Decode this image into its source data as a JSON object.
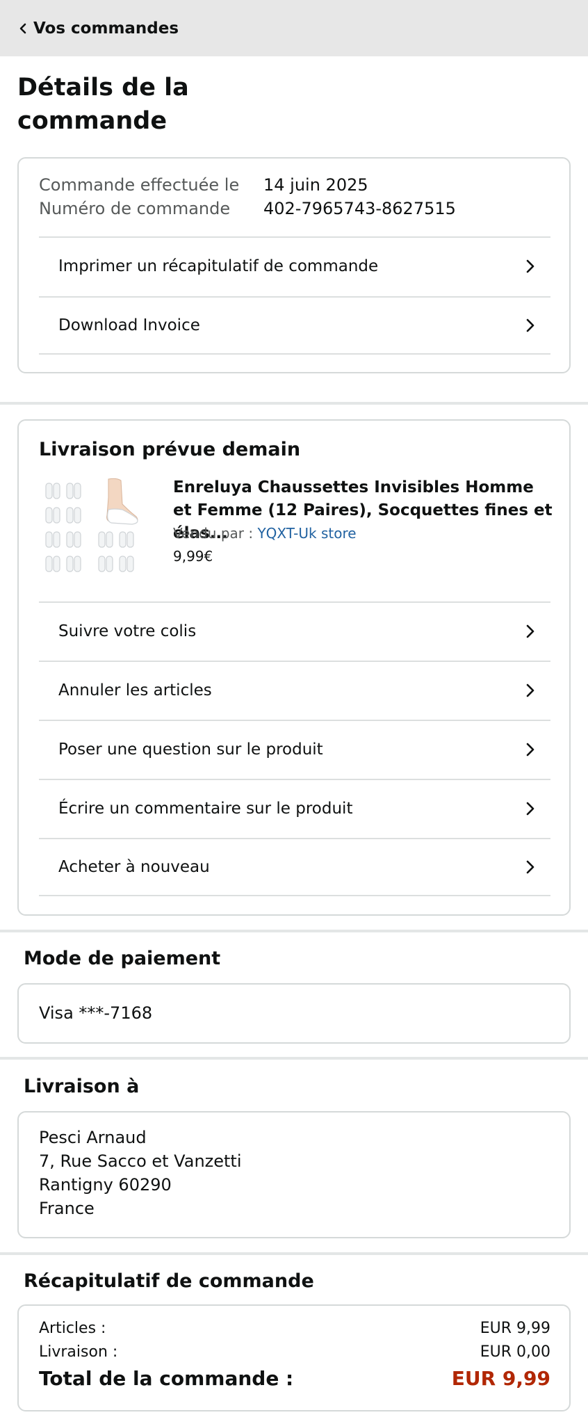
{
  "header": {
    "back_label": "Vos commandes"
  },
  "page": {
    "title": "Détails de la commande"
  },
  "order_info": {
    "placed_label": "Commande effectuée le",
    "placed_value": "14 juin 2025",
    "number_label": "Numéro de commande",
    "number_value": "402-7965743-8627515",
    "actions": [
      "Imprimer un récapitulatif de commande",
      "Download Invoice"
    ]
  },
  "shipment": {
    "title": "Livraison prévue demain",
    "product_title": "Enreluya Chaussettes Invisibles Homme et Femme (12 Paires), Socquettes fines et élas...",
    "sold_by_label": "Vendu par  :",
    "seller": "YQXT-Uk store",
    "price": "9,99€",
    "actions": [
      "Suivre votre colis",
      "Annuler les articles",
      "Poser une question sur le produit",
      "Écrire un commentaire sur le produit",
      "Acheter à nouveau"
    ]
  },
  "payment": {
    "title": "Mode de paiement",
    "method": "Visa ***-7168"
  },
  "delivery": {
    "title": "Livraison à",
    "name": "Pesci Arnaud",
    "street": "7, Rue Sacco et Vanzetti",
    "city": "Rantigny 60290",
    "country": "France"
  },
  "summary": {
    "title": "Récapitulatif de commande",
    "items_label": "Articles :",
    "items_value": "EUR 9,99",
    "shipping_label": "Livraison :",
    "shipping_value": "EUR 0,00",
    "total_label": "Total de la commande :",
    "total_value": "EUR 9,99",
    "total_color": "#b12704"
  },
  "icons": {
    "back": "chevron-left-icon",
    "row_arrow": "chevron-right-icon",
    "product": "socks-product-image"
  }
}
